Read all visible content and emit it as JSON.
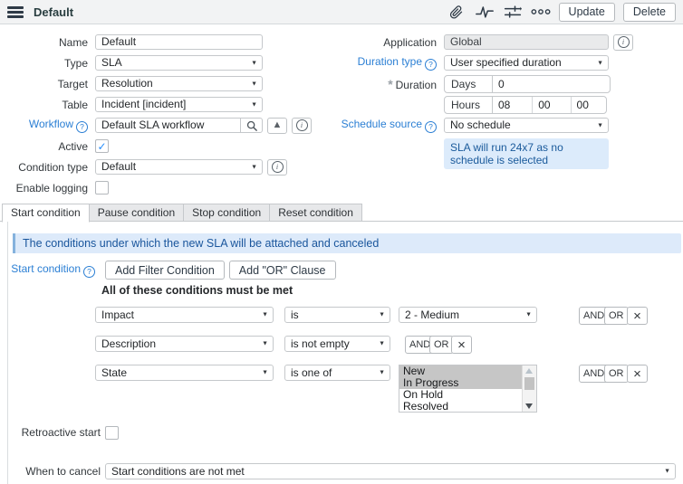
{
  "header": {
    "title": "Default",
    "update_label": "Update",
    "delete_label": "Delete"
  },
  "form": {
    "left": {
      "name": {
        "label": "Name",
        "value": "Default"
      },
      "type": {
        "label": "Type",
        "value": "SLA"
      },
      "target": {
        "label": "Target",
        "value": "Resolution"
      },
      "table": {
        "label": "Table",
        "value": "Incident [incident]"
      },
      "workflow": {
        "label": "Workflow",
        "value": "Default SLA workflow"
      },
      "active": {
        "label": "Active",
        "checked": true
      },
      "condition_type": {
        "label": "Condition type",
        "value": "Default"
      },
      "enable_logging": {
        "label": "Enable logging",
        "checked": false
      }
    },
    "right": {
      "application": {
        "label": "Application",
        "value": "Global"
      },
      "duration_type": {
        "label": "Duration type",
        "value": "User specified duration"
      },
      "duration": {
        "label": "Duration",
        "days_label": "Days",
        "days": "0",
        "hours_label": "Hours",
        "hours": "08",
        "minutes": "00",
        "seconds": "00"
      },
      "schedule_source": {
        "label": "Schedule source",
        "value": "No schedule"
      },
      "schedule_note": "SLA will run 24x7 as no schedule is selected"
    }
  },
  "tabs": [
    {
      "label": "Start condition"
    },
    {
      "label": "Pause condition"
    },
    {
      "label": "Stop condition"
    },
    {
      "label": "Reset condition"
    }
  ],
  "tab_panel": {
    "info_message": "The conditions under which the new SLA will be attached and canceled",
    "start_condition_label": "Start condition",
    "add_filter_button": "Add Filter Condition",
    "add_or_button": "Add \"OR\" Clause",
    "all_conditions_text": "All of these conditions must be met",
    "and_label": "AND",
    "or_label": "OR",
    "conditions": [
      {
        "field": "Impact",
        "operator": "is",
        "value": "2 - Medium"
      },
      {
        "field": "Description",
        "operator": "is not empty"
      },
      {
        "field": "State",
        "operator": "is one of",
        "options": [
          "New",
          "In Progress",
          "On Hold",
          "Resolved"
        ],
        "selected": [
          "New",
          "In Progress"
        ]
      }
    ],
    "retroactive": {
      "label": "Retroactive start",
      "checked": false
    },
    "when_to_cancel": {
      "label": "When to cancel",
      "value": "Start conditions are not met"
    }
  },
  "colors": {
    "accent_blue": "#2b7fd4",
    "check_blue": "#278efc",
    "info_bg": "#ddeafa",
    "info_border": "#85b2dd",
    "info_text": "#19559c",
    "header_bg": "#f2f3f4",
    "selected_option_bg": "#c6c6c6"
  }
}
